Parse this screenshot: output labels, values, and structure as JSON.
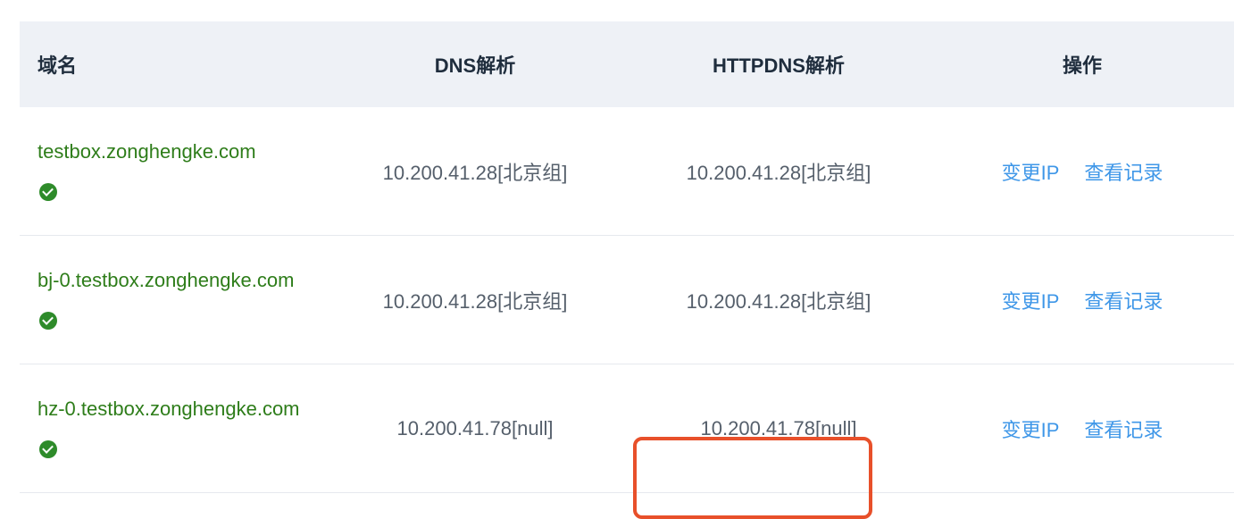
{
  "header": {
    "domain": "域名",
    "dns": "DNS解析",
    "httpdns": "HTTPDNS解析",
    "ops": "操作"
  },
  "rows": [
    {
      "domain": "testbox.zonghengke.com",
      "dns": "10.200.41.28[北京组]",
      "httpdns": "10.200.41.28[北京组]",
      "change_ip": "变更IP",
      "view_log": "查看记录"
    },
    {
      "domain": "bj-0.testbox.zonghengke.com",
      "dns": "10.200.41.28[北京组]",
      "httpdns": "10.200.41.28[北京组]",
      "change_ip": "变更IP",
      "view_log": "查看记录"
    },
    {
      "domain": "hz-0.testbox.zonghengke.com",
      "dns": "10.200.41.78[null]",
      "httpdns": "10.200.41.78[null]",
      "change_ip": "变更IP",
      "view_log": "查看记录"
    }
  ],
  "colors": {
    "domain_green": "#2e7d1a",
    "link_blue": "#3f97e8",
    "highlight_red": "#e8502a",
    "header_bg": "#eef1f6"
  },
  "icons": {
    "verified": "check-circle-icon"
  }
}
